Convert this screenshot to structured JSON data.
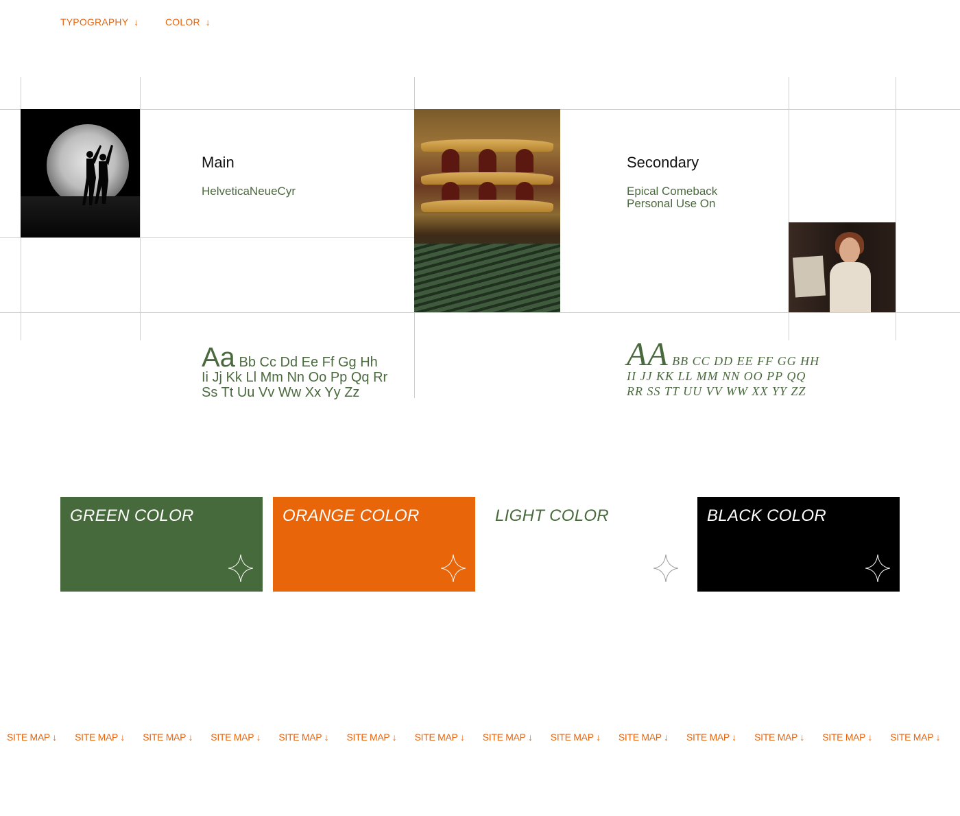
{
  "nav": [
    {
      "label": "TYPOGRAPHY",
      "arrow": "↓"
    },
    {
      "label": "COLOR",
      "arrow": "↓"
    }
  ],
  "typography": {
    "main": {
      "title": "Main",
      "font": "HelveticaNeueCyr",
      "alphabet_big": "Aa",
      "alphabet_lines": [
        "Bb Cc Dd Ee Ff Gg Hh",
        "Ii Jj Kk Ll Mm Nn Oo Pp Qq Rr",
        "Ss Tt Uu Vv Ww Xx Yy Zz"
      ]
    },
    "secondary": {
      "title": "Secondary",
      "font_line1": "Epical Comeback",
      "font_line2": "Personal Use On",
      "alphabet_big": "AA",
      "alphabet_lines": [
        "BB CC DD EE FF GG HH",
        "II JJ KK LL MM NN OO PP QQ",
        "RR SS TT UU VV WW XX YY ZZ"
      ]
    }
  },
  "colors": [
    {
      "label": "GREEN COLOR",
      "bg": "#476a3c",
      "text": "#ffffff",
      "star": "#ffffff"
    },
    {
      "label": "ORANGE COLOR",
      "bg": "#e8650a",
      "text": "#ffffff",
      "star": "#ffffff"
    },
    {
      "label": "LIGHT COLOR",
      "bg": "#ffffff",
      "text": "#476a3c",
      "star": "#9a9a9a"
    },
    {
      "label": "BLACK COLOR",
      "bg": "#000000",
      "text": "#ffffff",
      "star": "#ffffff"
    }
  ],
  "footer": {
    "sitemap_label": "SITE MAP ↓",
    "repeat_count": 14
  },
  "accent": "#e8640c",
  "green": "#476a3c"
}
